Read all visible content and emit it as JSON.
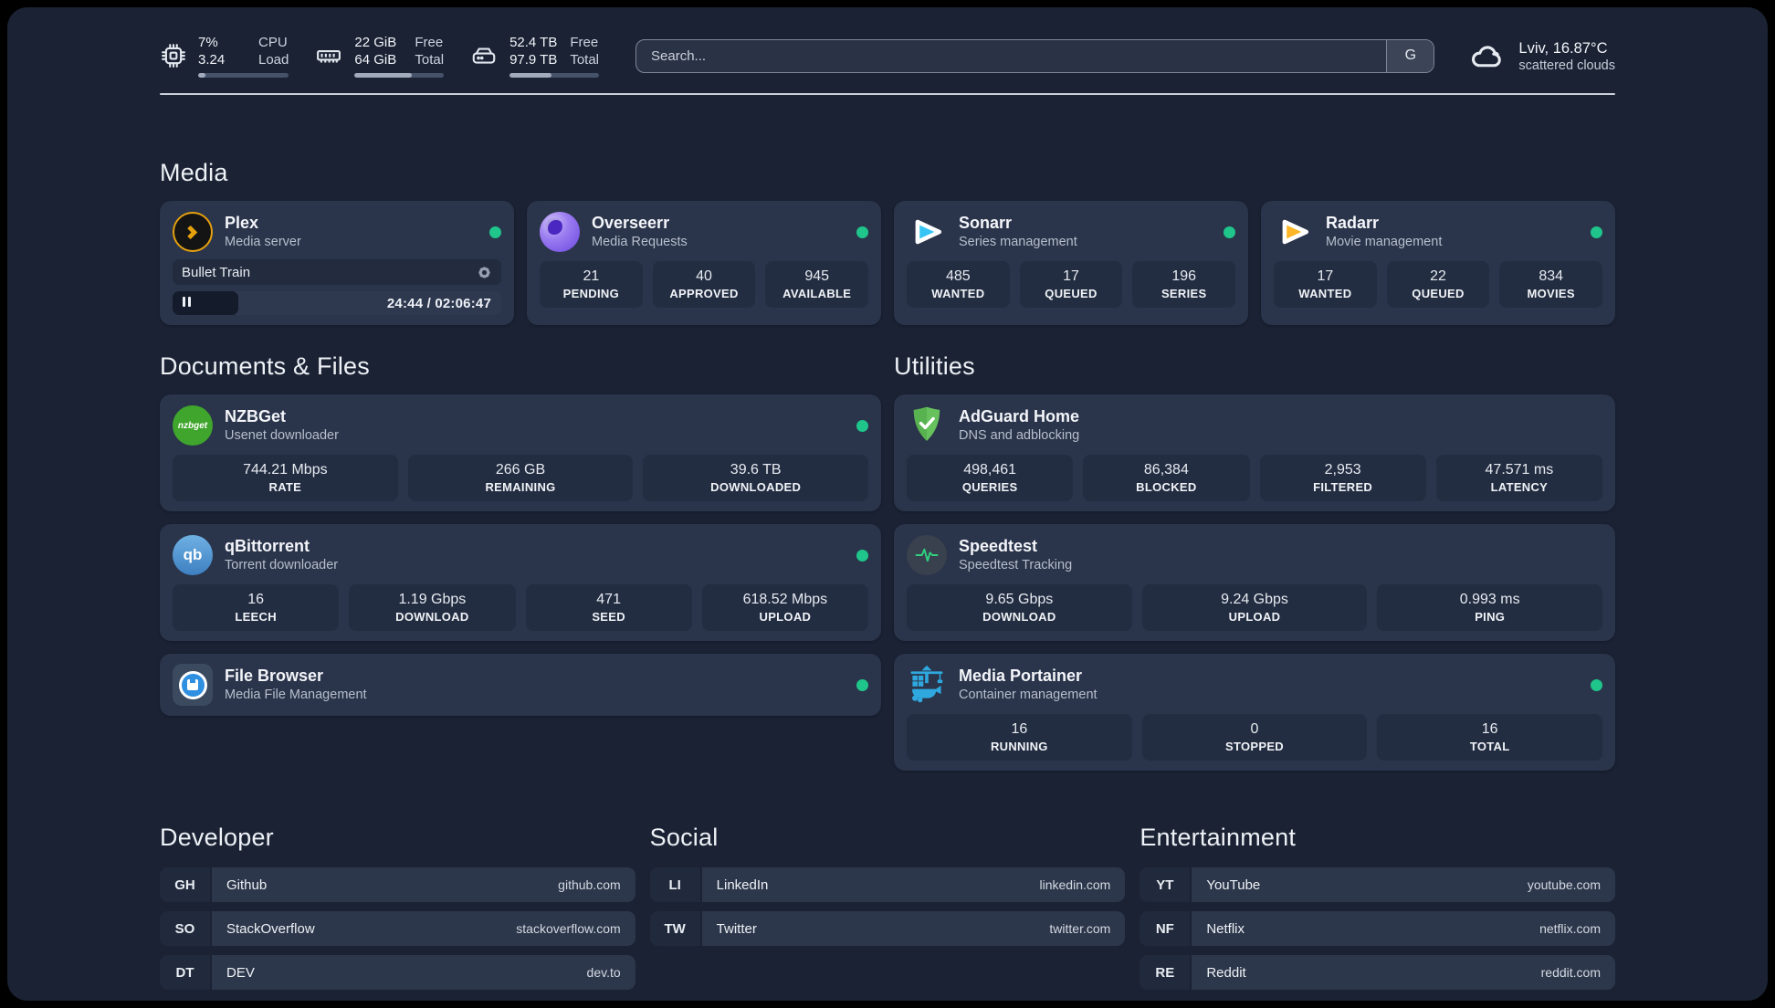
{
  "colors": {
    "status_online": "#1fc58b",
    "plex": "#e5a00d",
    "overseerr": "#7c5ce0",
    "sonarr": "#35c5f4",
    "radarr": "#ffb626",
    "nzbget": "#3fa52c",
    "qbittorrent": "#4c8fce",
    "adguard": "#67c25d",
    "speedtest_pulse": "#2fd180",
    "portainer": "#2fa8e0",
    "filebrowser": "#2f8fe0"
  },
  "header": {
    "system_stats": [
      {
        "icon": "cpu",
        "line1": "7%",
        "line2": "3.24",
        "label1": "CPU",
        "label2": "Load",
        "progress_pct": 8
      },
      {
        "icon": "ram",
        "line1": "22 GiB",
        "line2": "64 GiB",
        "label1": "Free",
        "label2": "Total",
        "progress_pct": 64
      },
      {
        "icon": "disk",
        "line1": "52.4 TB",
        "line2": "97.9 TB",
        "label1": "Free",
        "label2": "Total",
        "progress_pct": 47
      }
    ],
    "search": {
      "placeholder": "Search...",
      "engine_button": "G"
    },
    "weather": {
      "title": "Lviv, 16.87°C",
      "subtitle": "scattered clouds"
    }
  },
  "sections": {
    "media": {
      "title": "Media",
      "apps": [
        {
          "icon": "plex",
          "name": "Plex",
          "description": "Media server",
          "online": true,
          "player": {
            "title": "Bullet Train",
            "time": "24:44 / 02:06:47",
            "progress_pct": 20
          }
        },
        {
          "icon": "overseerr",
          "name": "Overseerr",
          "description": "Media Requests",
          "online": true,
          "stats": [
            {
              "value": "21",
              "label": "PENDING"
            },
            {
              "value": "40",
              "label": "APPROVED"
            },
            {
              "value": "945",
              "label": "AVAILABLE"
            }
          ]
        },
        {
          "icon": "sonarr",
          "name": "Sonarr",
          "description": "Series management",
          "online": true,
          "stats": [
            {
              "value": "485",
              "label": "WANTED"
            },
            {
              "value": "17",
              "label": "QUEUED"
            },
            {
              "value": "196",
              "label": "SERIES"
            }
          ]
        },
        {
          "icon": "radarr",
          "name": "Radarr",
          "description": "Movie management",
          "online": true,
          "stats": [
            {
              "value": "17",
              "label": "WANTED"
            },
            {
              "value": "22",
              "label": "QUEUED"
            },
            {
              "value": "834",
              "label": "MOVIES"
            }
          ]
        }
      ]
    },
    "documents": {
      "title": "Documents & Files",
      "apps": [
        {
          "icon": "nzbget",
          "name": "NZBGet",
          "description": "Usenet downloader",
          "online": true,
          "stats": [
            {
              "value": "744.21 Mbps",
              "label": "RATE"
            },
            {
              "value": "266 GB",
              "label": "REMAINING"
            },
            {
              "value": "39.6 TB",
              "label": "DOWNLOADED"
            }
          ]
        },
        {
          "icon": "qbittorrent",
          "name": "qBittorrent",
          "description": "Torrent downloader",
          "online": true,
          "stats": [
            {
              "value": "16",
              "label": "LEECH"
            },
            {
              "value": "1.19 Gbps",
              "label": "DOWNLOAD"
            },
            {
              "value": "471",
              "label": "SEED"
            },
            {
              "value": "618.52 Mbps",
              "label": "UPLOAD"
            }
          ]
        },
        {
          "icon": "filebrowser",
          "name": "File Browser",
          "description": "Media File Management",
          "online": true
        }
      ]
    },
    "utilities": {
      "title": "Utilities",
      "apps": [
        {
          "icon": "adguard",
          "name": "AdGuard Home",
          "description": "DNS and adblocking",
          "online": false,
          "stats": [
            {
              "value": "498,461",
              "label": "QUERIES"
            },
            {
              "value": "86,384",
              "label": "BLOCKED"
            },
            {
              "value": "2,953",
              "label": "FILTERED"
            },
            {
              "value": "47.571 ms",
              "label": "LATENCY"
            }
          ]
        },
        {
          "icon": "speedtest",
          "name": "Speedtest",
          "description": "Speedtest Tracking",
          "online": false,
          "stats": [
            {
              "value": "9.65 Gbps",
              "label": "DOWNLOAD"
            },
            {
              "value": "9.24 Gbps",
              "label": "UPLOAD"
            },
            {
              "value": "0.993 ms",
              "label": "PING"
            }
          ]
        },
        {
          "icon": "portainer",
          "name": "Media Portainer",
          "description": "Container management",
          "online": true,
          "stats": [
            {
              "value": "16",
              "label": "RUNNING"
            },
            {
              "value": "0",
              "label": "STOPPED"
            },
            {
              "value": "16",
              "label": "TOTAL"
            }
          ]
        }
      ]
    },
    "link_groups": [
      {
        "title": "Developer",
        "links": [
          {
            "abbr": "GH",
            "name": "Github",
            "url": "github.com"
          },
          {
            "abbr": "SO",
            "name": "StackOverflow",
            "url": "stackoverflow.com"
          },
          {
            "abbr": "DT",
            "name": "DEV",
            "url": "dev.to"
          }
        ]
      },
      {
        "title": "Social",
        "links": [
          {
            "abbr": "LI",
            "name": "LinkedIn",
            "url": "linkedin.com"
          },
          {
            "abbr": "TW",
            "name": "Twitter",
            "url": "twitter.com"
          }
        ]
      },
      {
        "title": "Entertainment",
        "links": [
          {
            "abbr": "YT",
            "name": "YouTube",
            "url": "youtube.com"
          },
          {
            "abbr": "NF",
            "name": "Netflix",
            "url": "netflix.com"
          },
          {
            "abbr": "RE",
            "name": "Reddit",
            "url": "reddit.com"
          }
        ]
      }
    ]
  }
}
